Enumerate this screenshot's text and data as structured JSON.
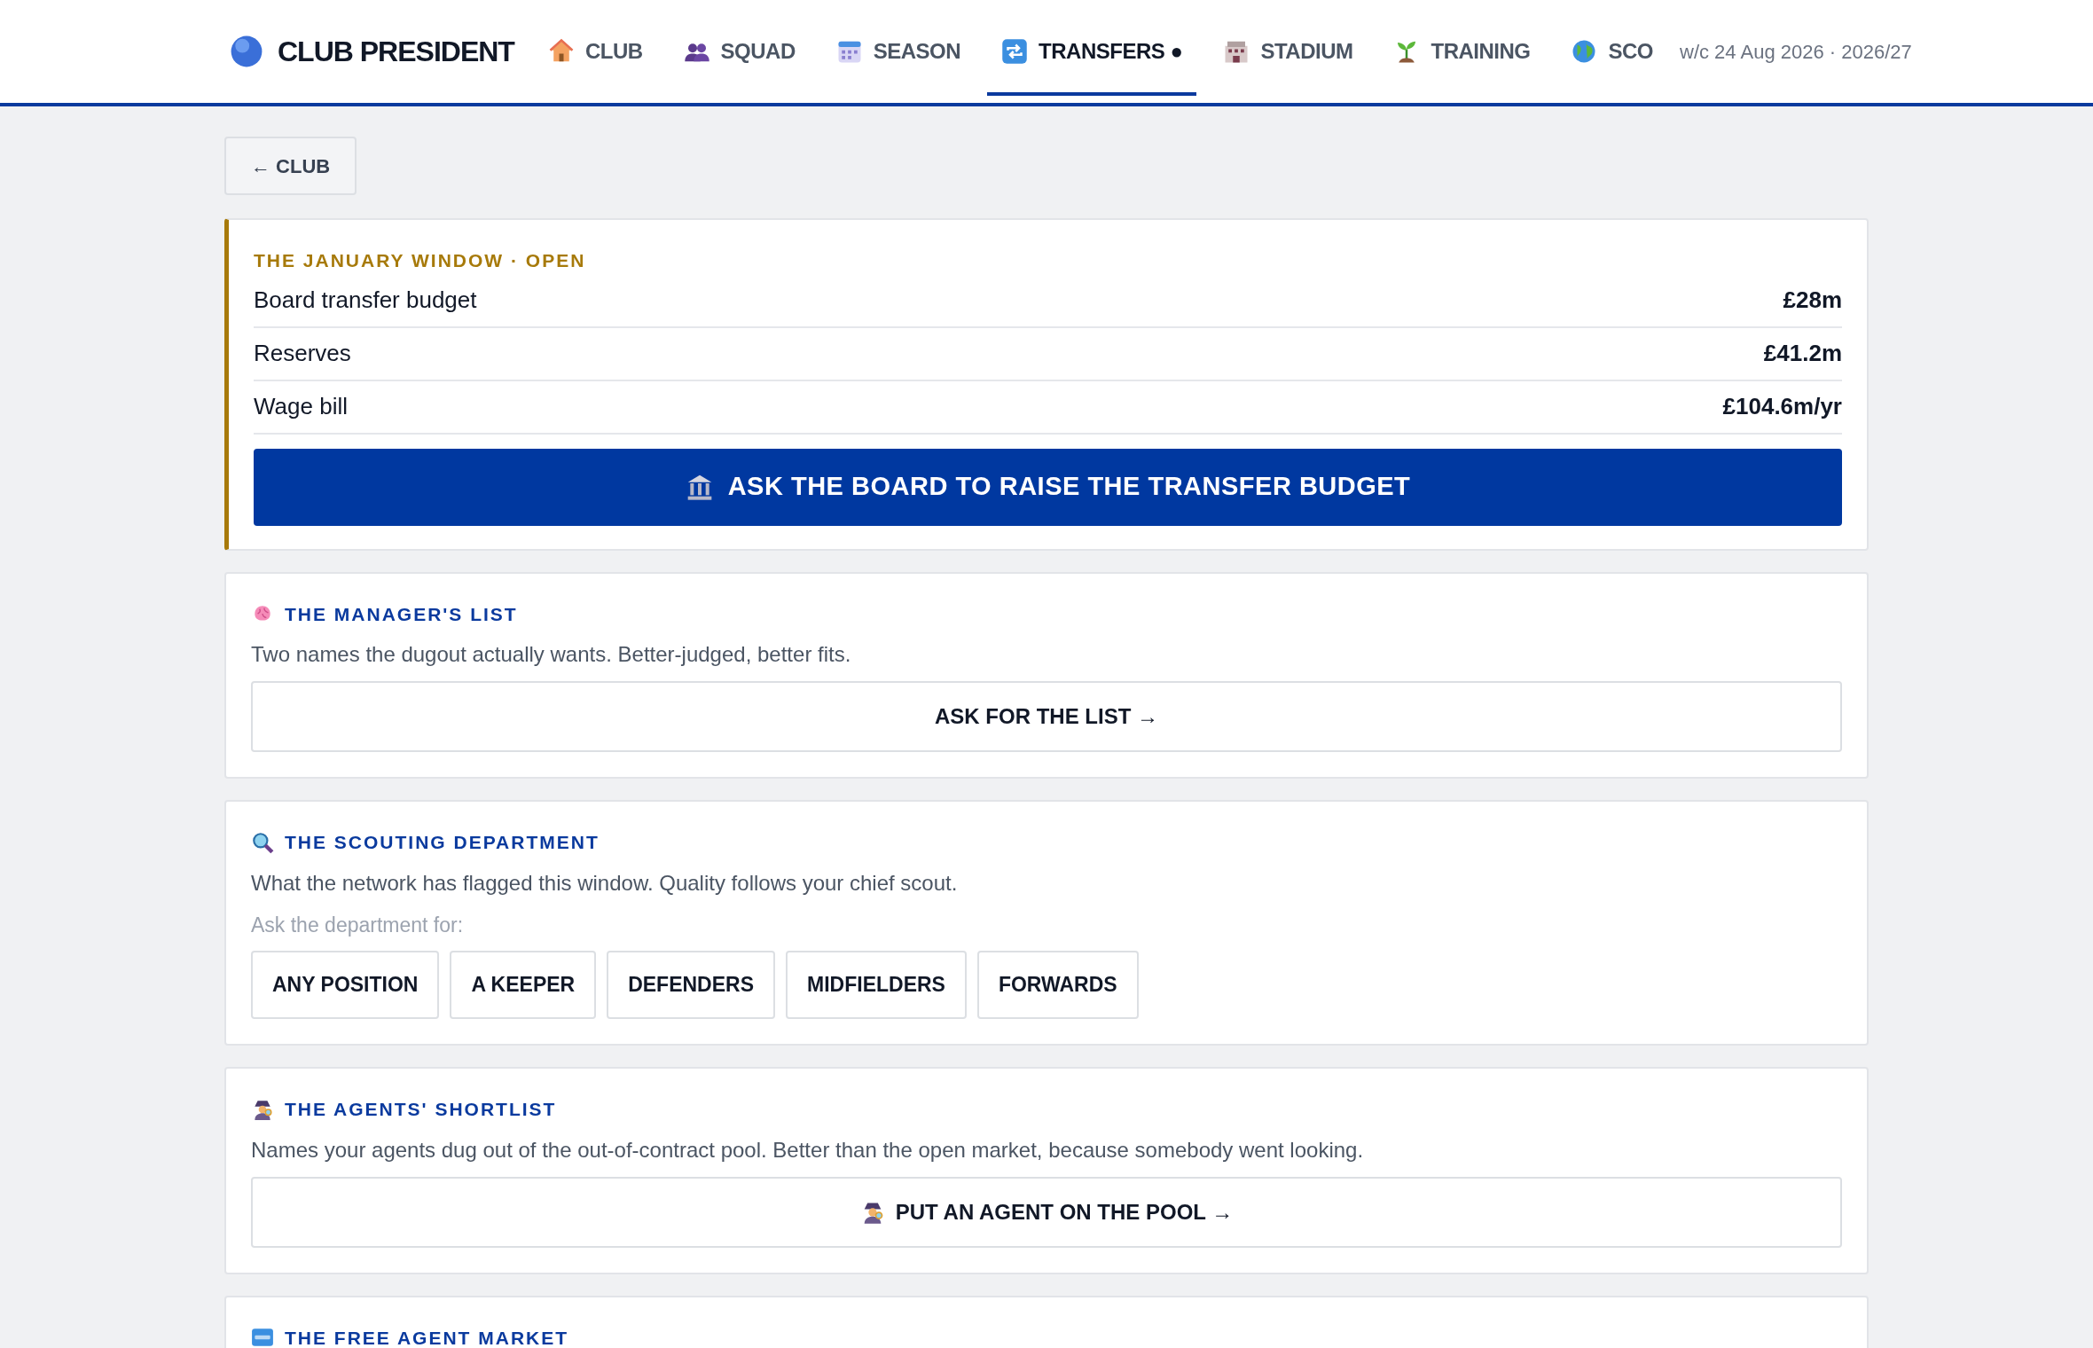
{
  "brand": "CLUB PRESIDENT",
  "nav": [
    {
      "label": "CLUB",
      "selected": false
    },
    {
      "label": "SQUAD",
      "selected": false
    },
    {
      "label": "SEASON",
      "selected": false
    },
    {
      "label": "TRANSFERS ●",
      "selected": true
    },
    {
      "label": "STADIUM",
      "selected": false
    },
    {
      "label": "TRAINING",
      "selected": false
    },
    {
      "label": "SCO",
      "selected": false
    }
  ],
  "date": "w/c 24 Aug 2026 · 2026/27",
  "back_button": "← CLUB",
  "window_card": {
    "title": "THE JANUARY WINDOW · OPEN",
    "rows": [
      {
        "label": "Board transfer budget",
        "value": "£28m"
      },
      {
        "label": "Reserves",
        "value": "£41.2m"
      },
      {
        "label": "Wage bill",
        "value": "£104.6m/yr"
      }
    ],
    "button": "ASK THE BOARD TO RAISE THE TRANSFER BUDGET"
  },
  "sections": [
    {
      "title": "THE MANAGER'S LIST",
      "description": "Two names the dugout actually wants. Better-judged, better fits.",
      "button": "ASK FOR THE LIST →"
    },
    {
      "title": "THE SCOUTING DEPARTMENT",
      "description": "What the network has flagged this window. Quality follows your chief scout.",
      "prompt": "Ask the department for:",
      "options": [
        "ANY POSITION",
        "A KEEPER",
        "DEFENDERS",
        "MIDFIELDERS",
        "FORWARDS"
      ]
    },
    {
      "title": "THE AGENTS' SHORTLIST",
      "description": "Names your agents dug out of the out-of-contract pool. Better than the open market, because somebody went looking.",
      "button": "PUT AN AGENT ON THE POOL →",
      "button_icon": true
    },
    {
      "title": "THE FREE AGENT MARKET"
    }
  ]
}
